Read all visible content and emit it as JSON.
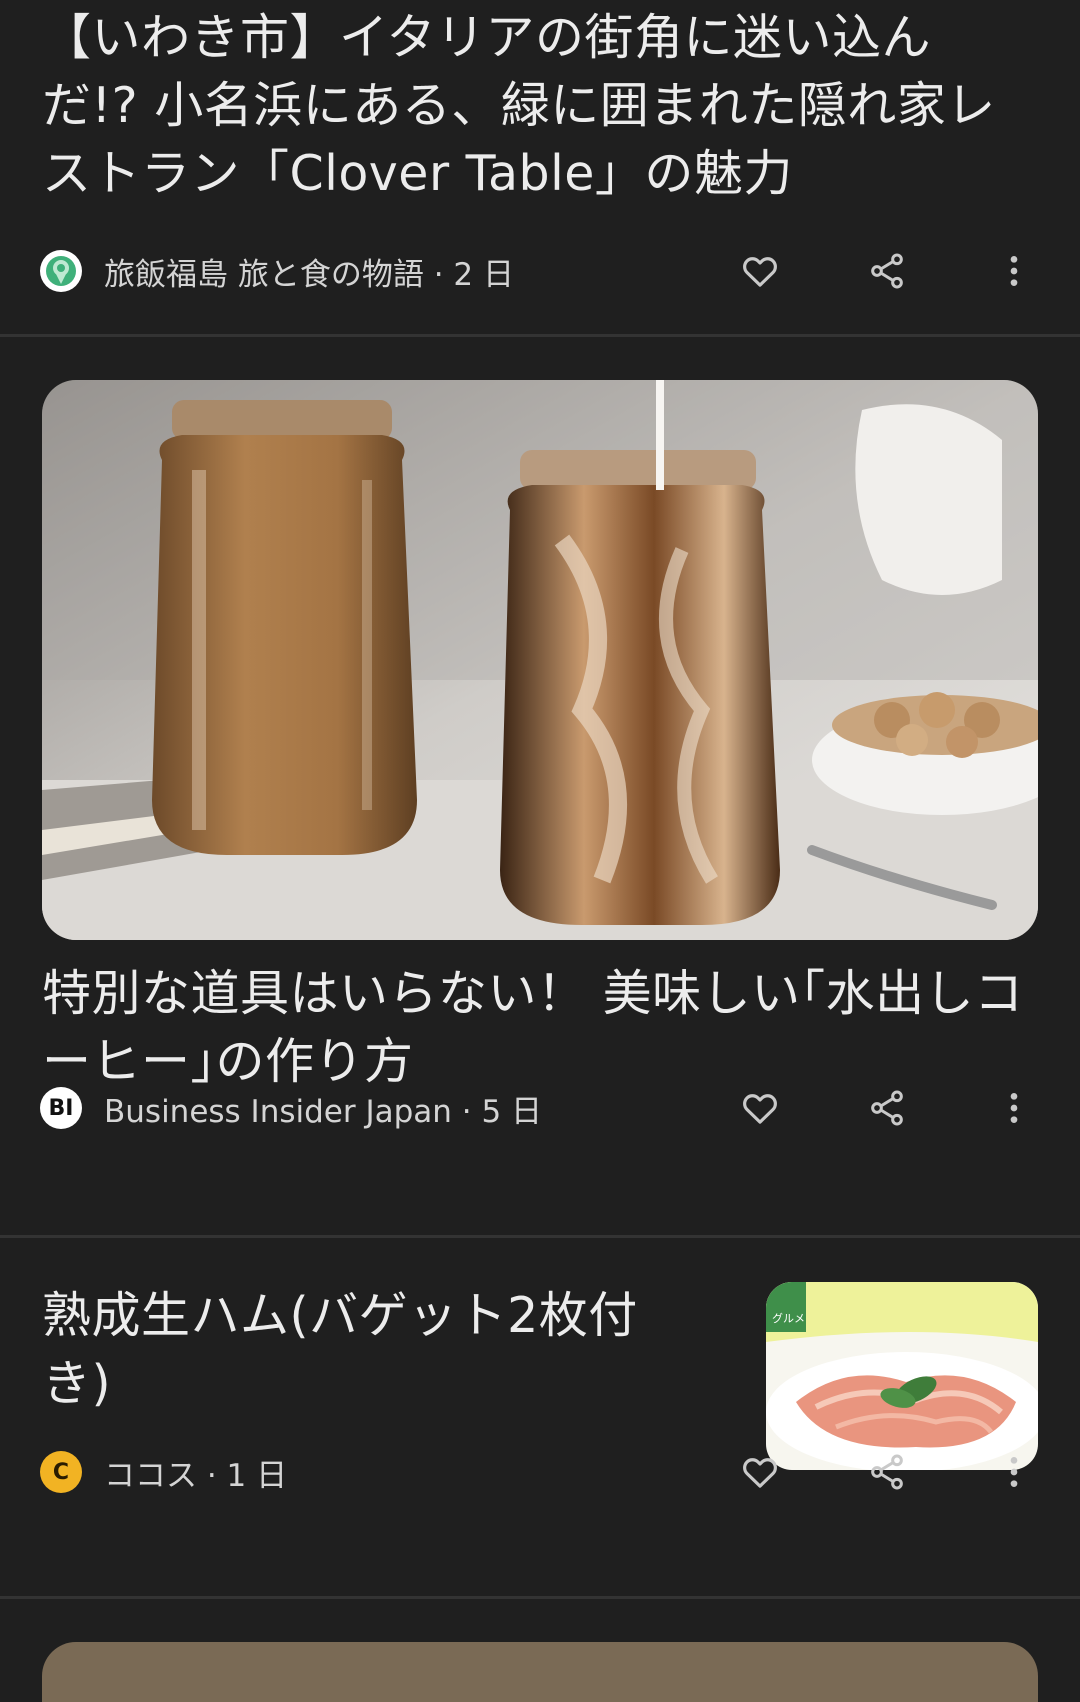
{
  "feed": {
    "articles": [
      {
        "title": "【いわき市】イタリアの街角に迷い込んだ!? 小名浜にある、緑に囲まれた隠れ家レストラン「Clover Table」の魅力",
        "source": "旅飯福島 旅と食の物語",
        "age": "2 日",
        "meta_text": "旅飯福島 旅と食の物語 · 2 日",
        "source_icon": "pin-logo-icon",
        "source_color": "#3fb07a"
      },
      {
        "title": "特別な道具はいらない！ 美味しい｢水出しコーヒー｣の作り方",
        "source": "Business Insider Japan",
        "age": "5 日",
        "meta_text": "Business Insider Japan · 5 日",
        "source_logo_text": "BI",
        "image_subject": "iced-coffee-jars-image"
      },
      {
        "title": "熟成生ハム(バゲット2枚付き)",
        "source": "ココス",
        "age": "1 日",
        "meta_text": "ココス · 1 日",
        "source_logo_text": "C",
        "source_color": "#f2b323",
        "image_subject": "prosciutto-plate-image",
        "thumb_badge": "グルメ"
      }
    ]
  },
  "actions": {
    "like_icon": "heart-icon",
    "share_icon": "share-icon",
    "more_icon": "more-vert-icon"
  },
  "colors": {
    "background": "#1f1f1f",
    "divider": "#333333",
    "icon": "#c9c9c9"
  }
}
